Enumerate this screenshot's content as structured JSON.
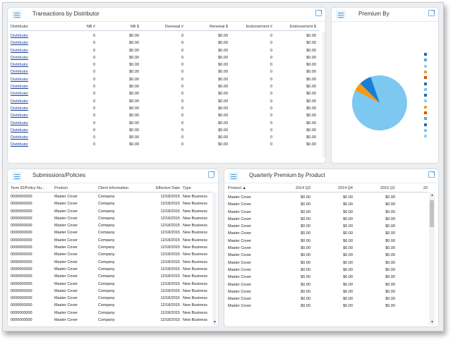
{
  "colors": {
    "accent": "#4a9ad6",
    "link": "#1a3f9e",
    "pie_main": "#7cc8f1"
  },
  "distributor_panel": {
    "title": "Transactions by Distributor",
    "columns": [
      "Distributor",
      "NB #",
      "NB $",
      "Renewal #",
      "Renewal $",
      "Endorsement #",
      "Endorsement $"
    ],
    "rows": [
      [
        "Distributor",
        "0",
        "$0.00",
        "0",
        "$0.00",
        "0",
        "$0.00"
      ],
      [
        "Distributor",
        "0",
        "$0.00",
        "0",
        "$0.00",
        "0",
        "$0.00"
      ],
      [
        "Distributor",
        "0",
        "$0.00",
        "0",
        "$0.00",
        "0",
        "$0.00"
      ],
      [
        "Distributor",
        "0",
        "$0.00",
        "0",
        "$0.00",
        "0",
        "$0.00"
      ],
      [
        "Distributor",
        "0",
        "$0.00",
        "0",
        "$0.00",
        "0",
        "$0.00"
      ],
      [
        "Distributor",
        "0",
        "$0.00",
        "0",
        "$0.00",
        "0",
        "$0.00"
      ],
      [
        "Distributor",
        "0",
        "$0.00",
        "0",
        "$0.00",
        "0",
        "$0.00"
      ],
      [
        "Distributor",
        "0",
        "$0.00",
        "0",
        "$0.00",
        "0",
        "$0.00"
      ],
      [
        "Distributor",
        "0",
        "$0.00",
        "0",
        "$0.00",
        "0",
        "$0.00"
      ],
      [
        "Distributor",
        "0",
        "$0.00",
        "0",
        "$0.00",
        "0",
        "$0.00"
      ],
      [
        "Distributor",
        "0",
        "$0.00",
        "0",
        "$0.00",
        "0",
        "$0.00"
      ],
      [
        "Distributor",
        "0",
        "$0.00",
        "0",
        "$0.00",
        "0",
        "$0.00"
      ],
      [
        "Distributor",
        "0",
        "$0.00",
        "0",
        "$0.00",
        "0",
        "$0.00"
      ],
      [
        "Distributor",
        "0",
        "$0.00",
        "0",
        "$0.00",
        "0",
        "$0.00"
      ],
      [
        "Distributor",
        "0",
        "$0.00",
        "0",
        "$0.00",
        "0",
        "$0.00"
      ],
      [
        "Distributor",
        "0",
        "$0.00",
        "0",
        "$0.00",
        "0",
        "$0.00"
      ]
    ]
  },
  "premium_panel": {
    "title": "Premium By",
    "legend_colors": [
      "#1f6fb0",
      "#5aa9e0",
      "#8fd0f5",
      "#f5a020",
      "#d45500",
      "#1f6fb0",
      "#7cc8f1",
      "#1f6fb0",
      "#8fd0f5",
      "#f5a020",
      "#d45500",
      "#5aa9e0",
      "#1f6fb0",
      "#7cc8f1",
      "#8fd0f5"
    ]
  },
  "submissions_panel": {
    "title": "Submissions/Policies",
    "columns": [
      "Term ID/Policy Nu...",
      "Product",
      "Client Information",
      "Effective Date",
      "Type"
    ],
    "rows": [
      [
        "0000000000",
        "Master Cover",
        "Company",
        "12/18/2015",
        "New Business"
      ],
      [
        "0000000000",
        "Master Cover",
        "Company",
        "12/18/2015",
        "New Business"
      ],
      [
        "0000000000",
        "Master Cover",
        "Company",
        "12/18/2015",
        "New Business"
      ],
      [
        "0000000000",
        "Master Cover",
        "Company",
        "12/18/2015",
        "New Business"
      ],
      [
        "0000000000",
        "Master Cover",
        "Company",
        "12/18/2015",
        "New Business"
      ],
      [
        "0000000000",
        "Master Cover",
        "Company",
        "12/18/2015",
        "New Business"
      ],
      [
        "0000000000",
        "Master Cover",
        "Company",
        "12/18/2015",
        "New Business"
      ],
      [
        "0000000000",
        "Master Cover",
        "Company",
        "12/18/2015",
        "New Business"
      ],
      [
        "0000000000",
        "Master Cover",
        "Company",
        "12/18/2015",
        "New Business"
      ],
      [
        "0000000000",
        "Master Cover",
        "Company",
        "12/18/2015",
        "New Business"
      ],
      [
        "0000000000",
        "Master Cover",
        "Company",
        "12/18/2015",
        "New Business"
      ],
      [
        "0000000000",
        "Master Cover",
        "Company",
        "12/18/2015",
        "New Business"
      ],
      [
        "0000000000",
        "Master Cover",
        "Company",
        "12/18/2015",
        "New Business"
      ],
      [
        "0000000000",
        "Master Cover",
        "Company",
        "12/18/2015",
        "New Business"
      ],
      [
        "0000000000",
        "Master Cover",
        "Company",
        "12/18/2015",
        "New Business"
      ],
      [
        "0000000000",
        "Master Cover",
        "Company",
        "12/18/2015",
        "New Business"
      ],
      [
        "0000000000",
        "Master Cover",
        "Company",
        "12/18/2015",
        "New Business"
      ],
      [
        "0000000000",
        "Master Cover",
        "Company",
        "12/18/2015",
        "New Business"
      ]
    ]
  },
  "quarterly_panel": {
    "title": "Quarterly Premium by Product",
    "columns": [
      "Product ▲",
      "2014 Q3",
      "2014 Q4",
      "2015 Q1",
      "20"
    ],
    "rows": [
      [
        "Master Cover",
        "$0.00",
        "$0.00",
        "$0.00"
      ],
      [
        "Master Cover",
        "$0.00",
        "$0.00",
        "$0.00"
      ],
      [
        "Master Cover",
        "$0.00",
        "$0.00",
        "$0.00"
      ],
      [
        "Master Cover",
        "$0.00",
        "$0.00",
        "$0.00"
      ],
      [
        "Master Cover",
        "$0.00",
        "$0.00",
        "$0.00"
      ],
      [
        "Master Cover",
        "$0.00",
        "$0.00",
        "$0.00"
      ],
      [
        "Master Cover",
        "$0.00",
        "$0.00",
        "$0.00"
      ],
      [
        "Master Cover",
        "$0.00",
        "$0.00",
        "$0.00"
      ],
      [
        "Master Cover",
        "$0.00",
        "$0.00",
        "$0.00"
      ],
      [
        "Master Cover",
        "$0.00",
        "$0.00",
        "$0.00"
      ],
      [
        "Master Cover",
        "$0.00",
        "$0.00",
        "$0.00"
      ],
      [
        "Master Cover",
        "$0.00",
        "$0.00",
        "$0.00"
      ],
      [
        "Master Cover",
        "$0.00",
        "$0.00",
        "$0.00"
      ],
      [
        "Master Cover",
        "$0.00",
        "$0.00",
        "$0.00"
      ],
      [
        "Master Cover",
        "$0.00",
        "$0.00",
        "$0.00"
      ],
      [
        "Master Cover",
        "$0.00",
        "$0.00",
        "$0.00"
      ]
    ]
  }
}
